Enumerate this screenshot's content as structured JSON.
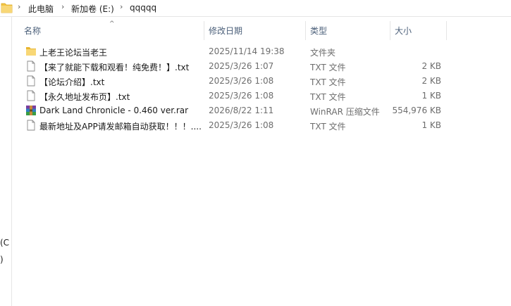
{
  "breadcrumb": {
    "items": [
      "此电脑",
      "新加卷 (E:)",
      "qqqqq"
    ]
  },
  "navpane": {
    "partial_labels": [
      "(C",
      ")"
    ]
  },
  "columns": {
    "name": "名称",
    "date": "修改日期",
    "type": "类型",
    "size": "大小"
  },
  "files": [
    {
      "name": "上老王论坛当老王",
      "date": "2025/11/14 19:38",
      "type": "文件夹",
      "size": "",
      "icon": "folder-icon"
    },
    {
      "name": "【来了就能下载和观看！纯免费！】.txt",
      "date": "2025/3/26 1:07",
      "type": "TXT 文件",
      "size": "2 KB",
      "icon": "txt-file-icon"
    },
    {
      "name": "【论坛介绍】.txt",
      "date": "2025/3/26 1:08",
      "type": "TXT 文件",
      "size": "2 KB",
      "icon": "txt-file-icon"
    },
    {
      "name": "【永久地址发布页】.txt",
      "date": "2025/3/26 1:08",
      "type": "TXT 文件",
      "size": "1 KB",
      "icon": "txt-file-icon"
    },
    {
      "name": "Dark Land Chronicle - 0.460 ver.rar",
      "date": "2026/8/22 1:11",
      "type": "WinRAR 压缩文件",
      "size": "554,976 KB",
      "icon": "winrar-archive-icon"
    },
    {
      "name": "最新地址及APP请发邮箱自动获取！！！....",
      "date": "2025/3/26 1:08",
      "type": "TXT 文件",
      "size": "1 KB",
      "icon": "txt-file-icon"
    }
  ],
  "colors": {
    "header_text": "#4c607a",
    "meta_text": "#6d6d6d",
    "folder_yellow": "#f4c542",
    "divider": "#e5e5e5"
  }
}
